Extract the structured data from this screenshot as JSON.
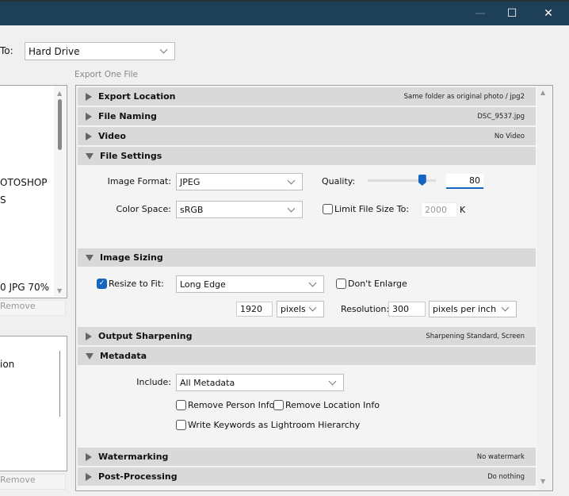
{
  "window": {
    "minimize": "—",
    "maximize": "☐",
    "close": "✕"
  },
  "export_to": {
    "label": "To:",
    "value": "Hard Drive"
  },
  "preset_label": "Export One File",
  "left_panels": {
    "presets": [
      "OTOSHOP",
      "S",
      "0 JPG 70%"
    ],
    "remove": "Remove",
    "plugins": [
      "ion"
    ],
    "remove2": "Remove"
  },
  "sections": {
    "export_location": {
      "title": "Export Location",
      "summary": "Same folder as original photo / jpg2"
    },
    "file_naming": {
      "title": "File Naming",
      "summary": "DSC_9537.jpg"
    },
    "video": {
      "title": "Video",
      "summary": "No Video"
    },
    "file_settings": {
      "title": "File Settings",
      "image_format_label": "Image Format:",
      "image_format": "JPEG",
      "color_space_label": "Color Space:",
      "color_space": "sRGB",
      "quality_label": "Quality:",
      "quality": "80",
      "quality_slider_percent": 80,
      "limit_label": "Limit File Size To:",
      "limit_checked": false,
      "limit_value": "2000",
      "limit_unit": "K"
    },
    "image_sizing": {
      "title": "Image Sizing",
      "resize_label": "Resize to Fit:",
      "resize_checked": true,
      "resize_mode": "Long Edge",
      "dont_enlarge": "Don't Enlarge",
      "dont_enlarge_checked": false,
      "size": "1920",
      "size_unit": "pixels",
      "resolution_label": "Resolution:",
      "resolution": "300",
      "resolution_unit": "pixels per inch"
    },
    "output_sharpening": {
      "title": "Output Sharpening",
      "summary": "Sharpening Standard, Screen"
    },
    "metadata": {
      "title": "Metadata",
      "include_label": "Include:",
      "include": "All Metadata",
      "remove_person": "Remove Person Info",
      "remove_location": "Remove Location Info",
      "write_keywords": "Write Keywords as Lightroom Hierarchy"
    },
    "watermarking": {
      "title": "Watermarking",
      "summary": "No watermark"
    },
    "post_processing": {
      "title": "Post-Processing",
      "summary": "Do nothing"
    }
  },
  "colors": {
    "titlebar": "#1e3f58",
    "accent": "#1565c0"
  }
}
